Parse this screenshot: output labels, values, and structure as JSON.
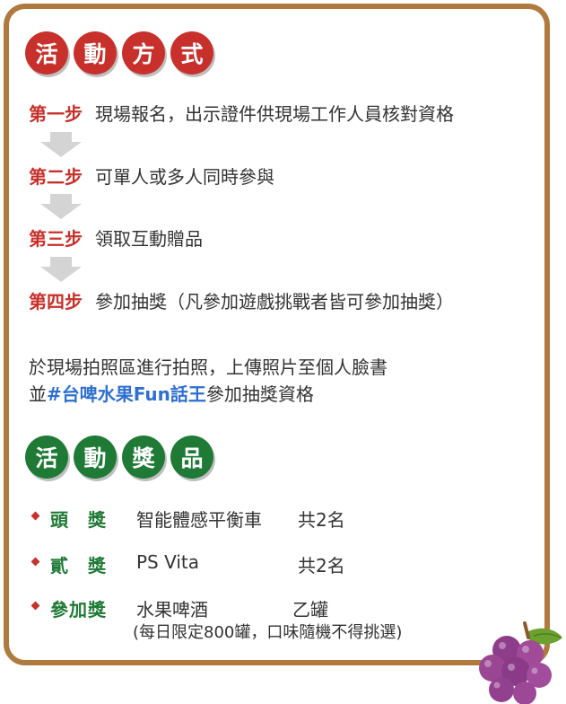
{
  "section1": {
    "title_chars": [
      "活",
      "動",
      "方",
      "式"
    ]
  },
  "steps": [
    {
      "label": "第一步",
      "text": "現場報名，出示證件供現場工作人員核對資格"
    },
    {
      "label": "第二步",
      "text": "可單人或多人同時參與"
    },
    {
      "label": "第三步",
      "text": "領取互動贈品"
    },
    {
      "label": "第四步",
      "text": "參加抽獎（凡參加遊戲挑戰者皆可參加抽獎）"
    }
  ],
  "note": {
    "line1": "於現場拍照區進行拍照，上傳照片至個人臉書",
    "line2_prefix": "並",
    "hashtag": "#台啤水果Fun話王",
    "line2_suffix": "參加抽獎資格"
  },
  "section2": {
    "title_chars": [
      "活",
      "動",
      "獎",
      "品"
    ]
  },
  "prizes": [
    {
      "label": "頭　獎",
      "name": "智能體感平衡車",
      "count": "共2名"
    },
    {
      "label": "貳　獎",
      "name": "PS Vita",
      "count": "共2名"
    },
    {
      "label": "參加獎",
      "name": "水果啤酒",
      "count": "乙罐"
    }
  ],
  "prize_note": "(每日限定800罐，口味隨機不得挑選)",
  "colors": {
    "red": "#c8312b",
    "green": "#1f7a36",
    "blue": "#2e6fd0",
    "border": "#b07a3e",
    "arrow": "#d4d4d4"
  },
  "icons": {
    "decoration": "grapes-icon",
    "arrow": "down-arrow-icon",
    "bullet": "diamond-bullet-icon"
  }
}
